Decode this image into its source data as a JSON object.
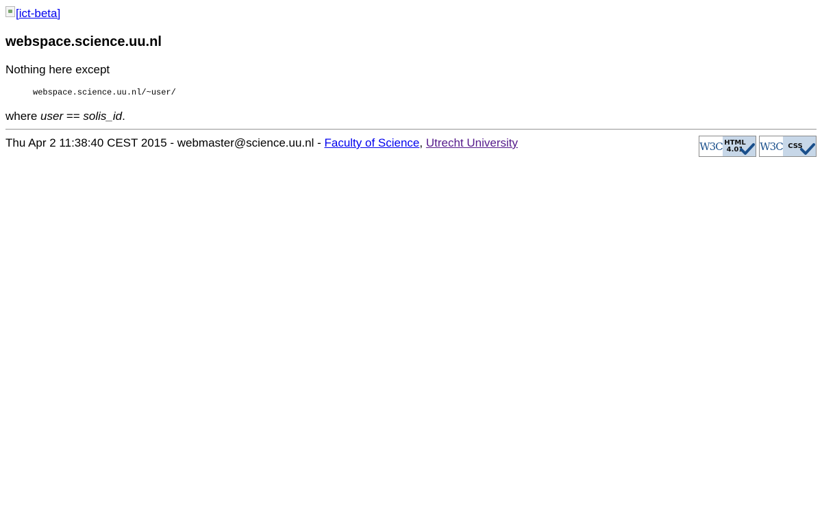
{
  "header": {
    "logo_alt": "[ict-beta]"
  },
  "main": {
    "title": "webspace.science.uu.nl",
    "intro": "Nothing here except",
    "code": "webspace.science.uu.nl/~user/",
    "where_prefix": "where ",
    "where_user": "user",
    "where_mid": " == ",
    "where_id": "solis_id",
    "where_suffix": "."
  },
  "footer": {
    "timestamp_and_email": "Thu Apr 2 11:38:40 CEST 2015 - webmaster@science.uu.nl - ",
    "link_faculty": "Faculty of Science",
    "separator": ", ",
    "link_university": "Utrecht University",
    "badges": [
      {
        "icon": "w3c-html401-icon",
        "w3c_text": "W3C",
        "line1": "HTML",
        "line2": "4.01"
      },
      {
        "icon": "w3c-css-icon",
        "w3c_text": "W3C",
        "line1": "CSS",
        "line2": ""
      }
    ]
  },
  "colors": {
    "link": "#0000ee",
    "visited_link": "#551a8b",
    "badge_bg": "#c7d7e8",
    "w3c_blue": "#1a4f8b"
  }
}
